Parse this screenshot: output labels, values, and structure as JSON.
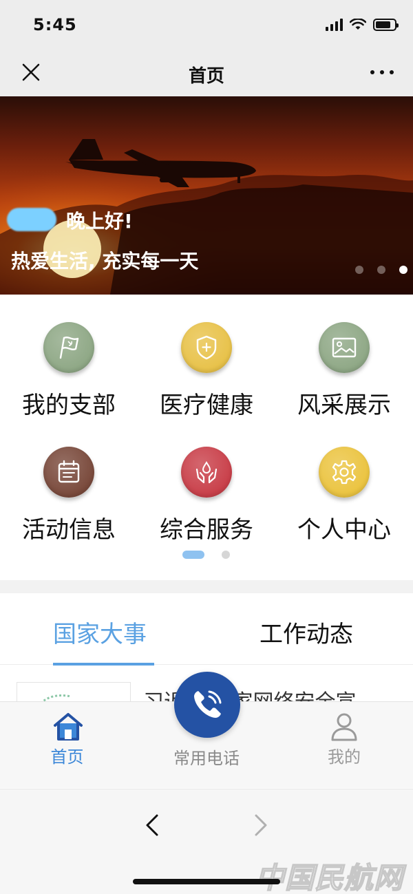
{
  "status_bar": {
    "time": "5:45",
    "battery_level": 0.8
  },
  "title_bar": {
    "title": "首页",
    "close_icon": "close-icon",
    "more_icon": "more-dots-icon"
  },
  "banner": {
    "greeting": "晚上好!",
    "slogan": "热爱生活, 充实每一天",
    "slide_count": 3,
    "active_slide": 3
  },
  "menu": {
    "items": [
      {
        "label": "我的支部",
        "icon": "flag-icon",
        "color": "#8fa886"
      },
      {
        "label": "医疗健康",
        "icon": "shield-plus-icon",
        "color": "#e8c24a"
      },
      {
        "label": "风采展示",
        "icon": "image-icon",
        "color": "#8fa886"
      },
      {
        "label": "活动信息",
        "icon": "calendar-icon",
        "color": "#7a4a3c"
      },
      {
        "label": "综合服务",
        "icon": "hands-drop-icon",
        "color": "#c9404a"
      },
      {
        "label": "个人中心",
        "icon": "gear-icon",
        "color": "#ebc441"
      }
    ],
    "page_count": 2,
    "active_page": 1
  },
  "tabs": [
    {
      "label": "国家大事",
      "active": true
    },
    {
      "label": "工作动态",
      "active": false
    }
  ],
  "news": {
    "title_visible": "习近平 国家网络安全宣"
  },
  "bottom_nav": {
    "home": "首页",
    "phone": "常用电话",
    "mine": "我的"
  },
  "colors": {
    "accent": "#5aa1e2",
    "fab": "#2452a4"
  },
  "watermark": "中国民航网"
}
